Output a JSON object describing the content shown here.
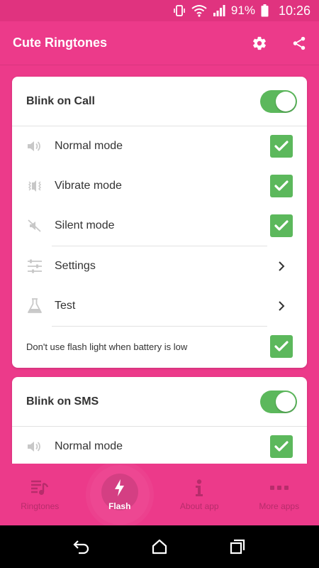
{
  "status": {
    "battery": "91%",
    "time": "10:26"
  },
  "appbar": {
    "title": "Cute Ringtones",
    "settings_icon": "gear-icon",
    "share_icon": "share-icon"
  },
  "cards": [
    {
      "title": "Blink on Call",
      "enabled": true,
      "modes": [
        {
          "label": "Normal mode",
          "icon": "speaker-icon",
          "checked": true
        },
        {
          "label": "Vibrate mode",
          "icon": "vibrate-icon",
          "checked": true
        },
        {
          "label": "Silent mode",
          "icon": "mute-icon",
          "checked": true
        }
      ],
      "links": [
        {
          "label": "Settings",
          "icon": "sliders-icon"
        },
        {
          "label": "Test",
          "icon": "flask-icon"
        }
      ],
      "battery_option": {
        "label": "Don't use flash light when battery is low",
        "checked": true
      }
    },
    {
      "title": "Blink on SMS",
      "enabled": true,
      "modes": [
        {
          "label": "Normal mode",
          "icon": "speaker-icon",
          "checked": true
        }
      ]
    }
  ],
  "bottom_nav": [
    {
      "label": "Ringtones",
      "icon": "music-list-icon",
      "active": false
    },
    {
      "label": "Flash",
      "icon": "lightning-icon",
      "active": true
    },
    {
      "label": "About app",
      "icon": "info-icon",
      "active": false
    },
    {
      "label": "More apps",
      "icon": "more-icon",
      "active": false
    }
  ],
  "colors": {
    "primary": "#ec3a8a",
    "accent_green": "#5cb85c",
    "nav_inactive": "#b72c6b"
  }
}
